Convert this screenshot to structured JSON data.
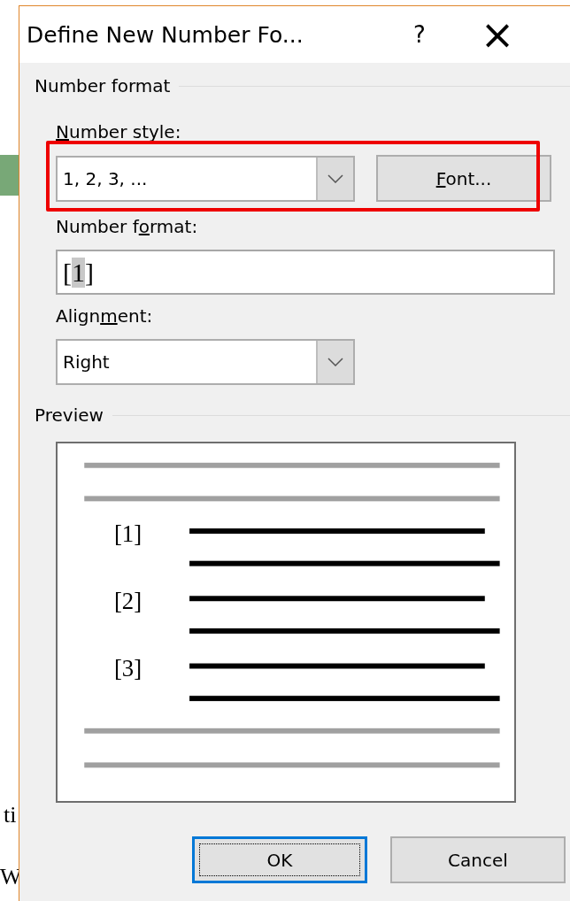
{
  "background": {
    "fragments": [
      "ti",
      "W"
    ]
  },
  "window": {
    "title": "Define New Number Fo...",
    "help": "?",
    "close": "×"
  },
  "number_format_group": {
    "title": "Number format",
    "number_style": {
      "access_key": "N",
      "label_after": "umber style:",
      "value": "1, 2, 3, ..."
    },
    "font_button": {
      "access_key": "F",
      "label_after": "ont..."
    },
    "number_format": {
      "label_before": "Number f",
      "access_key": "o",
      "label_after": "rmat:",
      "value_before": "[",
      "value_selected": "1",
      "value_after": "]"
    },
    "alignment": {
      "label_before": "Align",
      "access_key": "m",
      "label_after": "ent:",
      "value": "Right"
    }
  },
  "preview_group": {
    "title": "Preview",
    "items": [
      "[1]",
      "[2]",
      "[3]"
    ]
  },
  "buttons": [
    {
      "label": "OK",
      "default": true
    },
    {
      "label": "Cancel",
      "default": false
    }
  ]
}
